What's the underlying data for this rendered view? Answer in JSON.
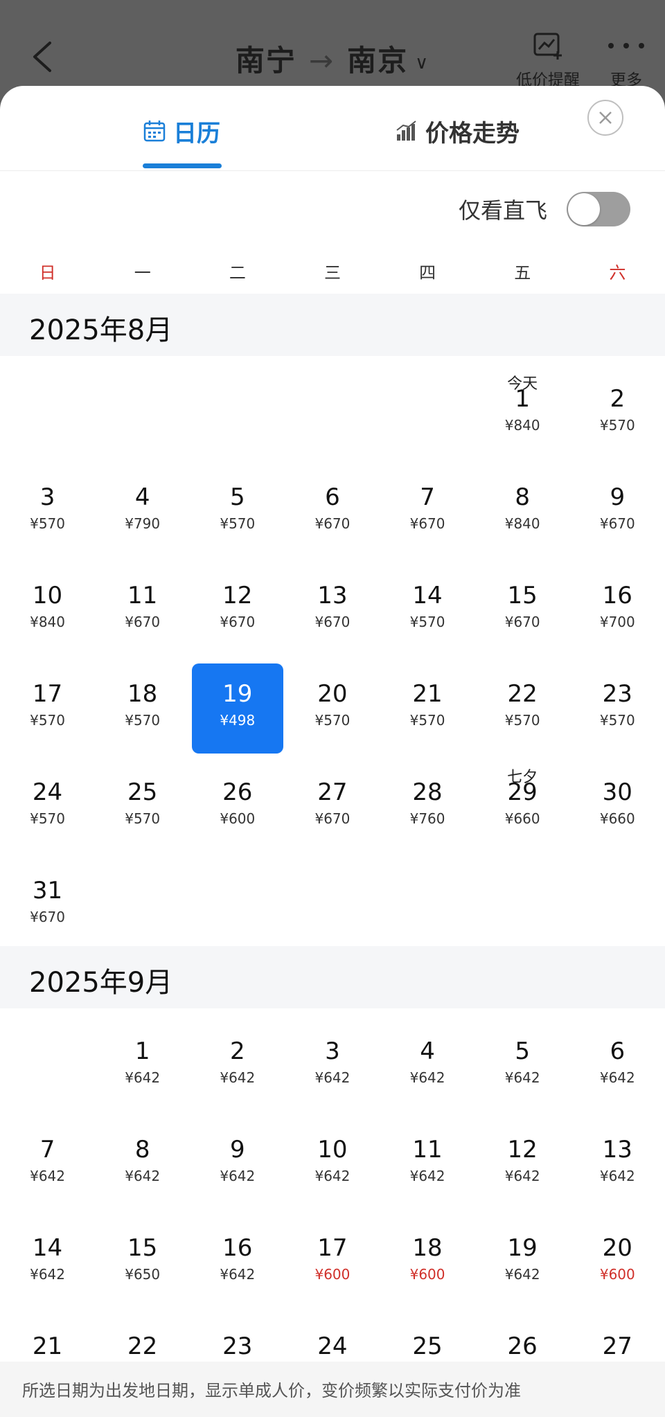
{
  "header": {
    "origin": "南宁",
    "arrow": "→",
    "destination": "南京",
    "chevron": "∨",
    "price_alert_label": "低价提醒",
    "more_label": "更多",
    "icons": [
      "back-arrow-icon",
      "price-alert-icon",
      "more-dots-icon"
    ]
  },
  "tabs": [
    {
      "label": "日历",
      "icon": "calendar-icon",
      "active": true
    },
    {
      "label": "价格走势",
      "icon": "bar-chart-icon",
      "active": false
    }
  ],
  "direct_only": {
    "label": "仅看直飞",
    "on": false
  },
  "weekdays": [
    "日",
    "一",
    "二",
    "三",
    "四",
    "五",
    "六"
  ],
  "colors": {
    "accent": "#1a7fd8",
    "selected": "#1677f2",
    "low_price": "#d0302a"
  },
  "months": [
    {
      "title": "2025年8月",
      "offset": 5,
      "days": [
        {
          "day": "1",
          "price": "¥840",
          "tag": "今天"
        },
        {
          "day": "2",
          "price": "¥570"
        },
        {
          "day": "3",
          "price": "¥570"
        },
        {
          "day": "4",
          "price": "¥790"
        },
        {
          "day": "5",
          "price": "¥570"
        },
        {
          "day": "6",
          "price": "¥670"
        },
        {
          "day": "7",
          "price": "¥670"
        },
        {
          "day": "8",
          "price": "¥840"
        },
        {
          "day": "9",
          "price": "¥670"
        },
        {
          "day": "10",
          "price": "¥840"
        },
        {
          "day": "11",
          "price": "¥670"
        },
        {
          "day": "12",
          "price": "¥670"
        },
        {
          "day": "13",
          "price": "¥670"
        },
        {
          "day": "14",
          "price": "¥570"
        },
        {
          "day": "15",
          "price": "¥670"
        },
        {
          "day": "16",
          "price": "¥700"
        },
        {
          "day": "17",
          "price": "¥570"
        },
        {
          "day": "18",
          "price": "¥570"
        },
        {
          "day": "19",
          "price": "¥498",
          "selected": true
        },
        {
          "day": "20",
          "price": "¥570"
        },
        {
          "day": "21",
          "price": "¥570"
        },
        {
          "day": "22",
          "price": "¥570"
        },
        {
          "day": "23",
          "price": "¥570"
        },
        {
          "day": "24",
          "price": "¥570"
        },
        {
          "day": "25",
          "price": "¥570"
        },
        {
          "day": "26",
          "price": "¥600"
        },
        {
          "day": "27",
          "price": "¥670"
        },
        {
          "day": "28",
          "price": "¥760"
        },
        {
          "day": "29",
          "price": "¥660",
          "tag": "七夕"
        },
        {
          "day": "30",
          "price": "¥660"
        },
        {
          "day": "31",
          "price": "¥670"
        }
      ]
    },
    {
      "title": "2025年9月",
      "offset": 1,
      "days": [
        {
          "day": "1",
          "price": "¥642"
        },
        {
          "day": "2",
          "price": "¥642"
        },
        {
          "day": "3",
          "price": "¥642"
        },
        {
          "day": "4",
          "price": "¥642"
        },
        {
          "day": "5",
          "price": "¥642"
        },
        {
          "day": "6",
          "price": "¥642"
        },
        {
          "day": "7",
          "price": "¥642"
        },
        {
          "day": "8",
          "price": "¥642"
        },
        {
          "day": "9",
          "price": "¥642"
        },
        {
          "day": "10",
          "price": "¥642"
        },
        {
          "day": "11",
          "price": "¥642"
        },
        {
          "day": "12",
          "price": "¥642"
        },
        {
          "day": "13",
          "price": "¥642"
        },
        {
          "day": "14",
          "price": "¥642"
        },
        {
          "day": "15",
          "price": "¥650"
        },
        {
          "day": "16",
          "price": "¥642"
        },
        {
          "day": "17",
          "price": "¥600",
          "low": true
        },
        {
          "day": "18",
          "price": "¥600",
          "low": true
        },
        {
          "day": "19",
          "price": "¥642"
        },
        {
          "day": "20",
          "price": "¥600",
          "low": true
        },
        {
          "day": "21"
        },
        {
          "day": "22"
        },
        {
          "day": "23"
        },
        {
          "day": "24"
        },
        {
          "day": "25"
        },
        {
          "day": "26"
        },
        {
          "day": "27"
        }
      ]
    }
  ],
  "footer_note": "所选日期为出发地日期，显示单成人价，变价频繁以实际支付价为准"
}
